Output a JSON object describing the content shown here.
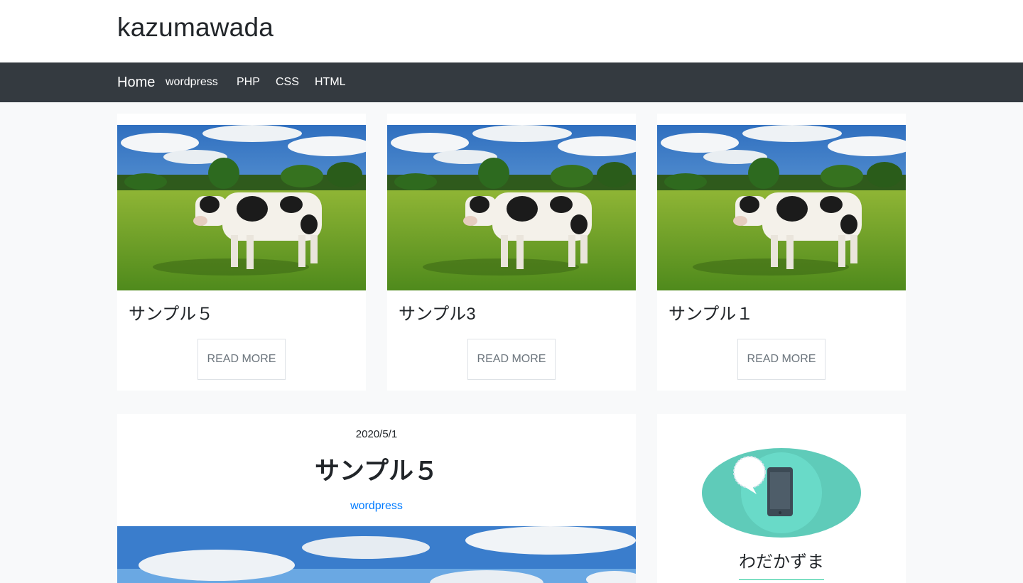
{
  "site": {
    "title": "kazumawada"
  },
  "nav": {
    "home": "Home",
    "items": [
      "wordpress",
      "PHP",
      "CSS",
      "HTML"
    ]
  },
  "cards": [
    {
      "title": "サンプル５",
      "button": "READ MORE"
    },
    {
      "title": "サンプル3",
      "button": "READ MORE"
    },
    {
      "title": "サンプル１",
      "button": "READ MORE"
    }
  ],
  "post": {
    "date": "2020/5/1",
    "title": "サンプル５",
    "category": "wordpress"
  },
  "profile": {
    "name": "わだかずま"
  },
  "colors": {
    "navbar": "#343a40",
    "link": "#007bff",
    "accent": "#20c997",
    "avatar_bg": "#5fcbb9"
  }
}
